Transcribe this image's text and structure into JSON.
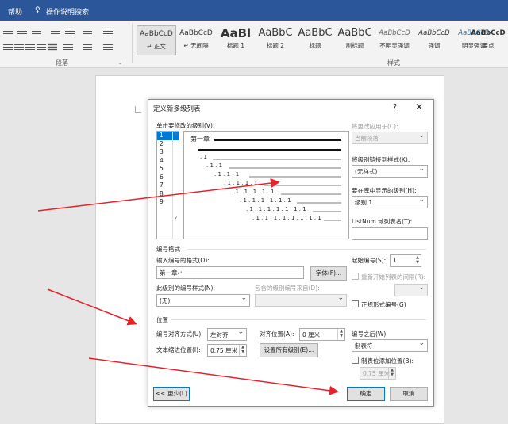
{
  "ribbon": {
    "help_tab": "帮助",
    "tell_me": "操作说明搜索",
    "paragraph_group": "段落",
    "styles_group": "样式",
    "styles": [
      {
        "sample": "AaBbCcD",
        "name": "↵ 正文"
      },
      {
        "sample": "AaBbCcD",
        "name": "↵ 无间隔"
      },
      {
        "sample": "AaBl",
        "name": "标题 1"
      },
      {
        "sample": "AaBbC",
        "name": "标题 2"
      },
      {
        "sample": "AaBbC",
        "name": "标题"
      },
      {
        "sample": "AaBbC",
        "name": "副标题"
      },
      {
        "sample": "AaBbCcD",
        "name": "不明显强调"
      },
      {
        "sample": "AaBbCcD",
        "name": "强调"
      },
      {
        "sample": "AaBbCcD",
        "name": "明显强调"
      },
      {
        "sample": "AaBbCcD",
        "name": "要点"
      }
    ]
  },
  "dialog": {
    "title": "定义新多级列表",
    "help": "?",
    "close": "✕",
    "click_level_label": "单击要修改的级别(V):",
    "levels": [
      "1",
      "2",
      "3",
      "4",
      "5",
      "6",
      "7",
      "8",
      "9"
    ],
    "preview_first": "第一章",
    "preview_rows": [
      ". 1",
      ". 1 . 1",
      ". 1 . 1 . 1",
      ". 1 . 1 . 1 . 1",
      ". 1 . 1 . 1 . 1 . 1",
      ". 1 . 1 . 1 . 1 . 1 . 1",
      ". 1 . 1 . 1 . 1 . 1 . 1 . 1",
      ". 1 . 1 . 1 . 1 . 1 . 1 . 1 . 1"
    ],
    "apply_to_label": "将更改应用于(C):",
    "apply_to_value": "当前段落",
    "link_style_label": "将级别链接到样式(K):",
    "link_style_value": "(无样式)",
    "gallery_level_label": "要在库中显示的级别(H):",
    "gallery_level_value": "级别 1",
    "listnum_label": "ListNum 域列表名(T):",
    "listnum_value": "",
    "number_format_section": "编号格式",
    "enter_format_label": "输入编号的格式(O):",
    "enter_format_value": "第一章↵",
    "font_button": "字体(F)...",
    "start_at_label": "起始编号(S):",
    "start_at_value": "1",
    "restart_label": "重新开始列表的间隔(R):",
    "number_style_label": "此级别的编号样式(N):",
    "number_style_value": "(无)",
    "include_level_label": "包含的级别编号来自(D):",
    "include_level_value": "",
    "legal_label": "正规形式编号(G)",
    "position_section": "位置",
    "alignment_label": "编号对齐方式(U):",
    "alignment_value": "左对齐",
    "aligned_at_label": "对齐位置(A):",
    "aligned_at_value": "0 厘米",
    "indent_label": "文本缩进位置(I):",
    "indent_value": "0.75 厘米",
    "set_all_button": "设置所有级别(E)...",
    "follow_label": "编号之后(W):",
    "follow_value": "制表符",
    "tab_stop_label": "制表位添加位置(B):",
    "tab_stop_value": "0.75 厘米",
    "less_button": "<< 更少(L)",
    "ok_button": "确定",
    "cancel_button": "取消"
  },
  "colors": {
    "ribbon_blue": "#2b579a",
    "selection_blue": "#0078d7",
    "annotation_red": "#e8202a"
  }
}
